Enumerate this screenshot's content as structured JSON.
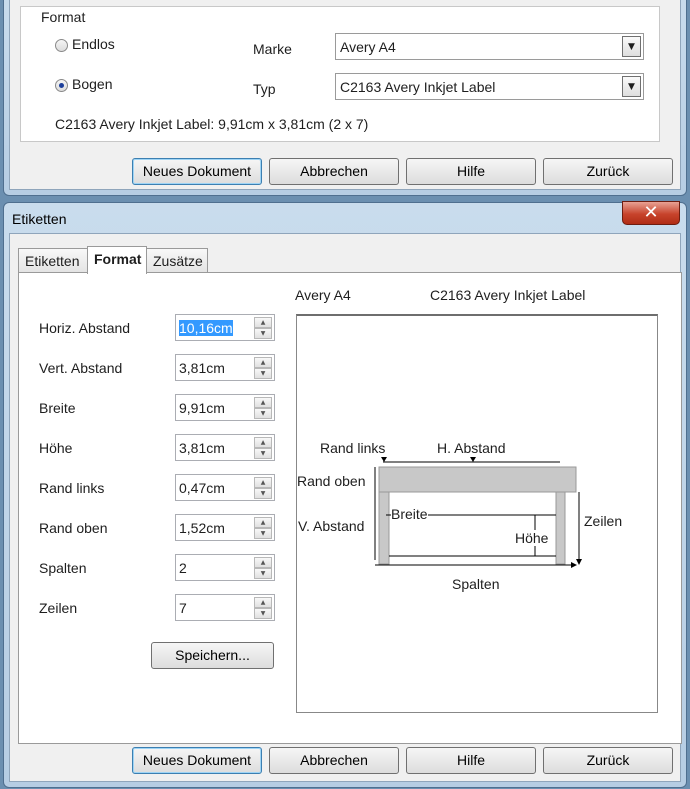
{
  "top_dialog": {
    "format_group_label": "Format",
    "radio_endlos": "Endlos",
    "radio_bogen": "Bogen",
    "marke_label": "Marke",
    "marke_value": "Avery A4",
    "typ_label": "Typ",
    "typ_value": "C2163 Avery Inkjet Label",
    "info_text": "C2163 Avery Inkjet Label: 9,91cm x 3,81cm (2 x 7)",
    "buttons": [
      "Neues Dokument",
      "Abbrechen",
      "Hilfe",
      "Zurück"
    ]
  },
  "dialog": {
    "title": "Etiketten",
    "close_glyph": "✕",
    "tabs": [
      "Etiketten",
      "Format",
      "Zusätze"
    ],
    "active_tab": "Format",
    "fields": [
      {
        "label": "Horiz. Abstand",
        "value": "10,16cm",
        "selected": true
      },
      {
        "label": "Vert. Abstand",
        "value": "3,81cm"
      },
      {
        "label": "Breite",
        "value": "9,91cm"
      },
      {
        "label": "Höhe",
        "value": "3,81cm"
      },
      {
        "label": "Rand links",
        "value": "0,47cm"
      },
      {
        "label": "Rand oben",
        "value": "1,52cm"
      },
      {
        "label": "Spalten",
        "value": "2"
      },
      {
        "label": "Zeilen",
        "value": "7"
      }
    ],
    "save_button": "Speichern...",
    "preview": {
      "brand": "Avery A4",
      "type": "C2163 Avery Inkjet Label",
      "labels": {
        "rand_links": "Rand links",
        "h_abstand": "H. Abstand",
        "rand_oben": "Rand oben",
        "v_abstand": "V. Abstand",
        "breite": "Breite",
        "hoehe": "Höhe",
        "zeilen": "Zeilen",
        "spalten": "Spalten"
      }
    },
    "buttons": [
      "Neues Dokument",
      "Abbrechen",
      "Hilfe",
      "Zurück"
    ]
  },
  "colors": {
    "selection": "#3399ff",
    "label_gray": "#c8c8c8",
    "close_red": "#c7432c"
  }
}
